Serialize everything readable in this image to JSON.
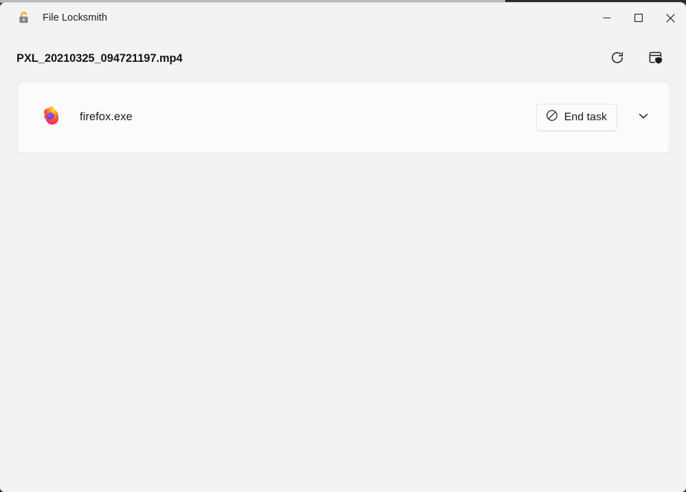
{
  "window": {
    "title": "File Locksmith",
    "app_icon": "unlocked-padlock-icon",
    "controls": {
      "minimize": "minimize-icon",
      "maximize": "maximize-icon",
      "close": "close-icon"
    }
  },
  "header": {
    "file_name": "PXL_20210325_094721197.mp4",
    "actions": [
      {
        "name": "refresh-icon",
        "label": "Refresh"
      },
      {
        "name": "restart-as-admin-icon",
        "label": "Restart as administrator"
      }
    ]
  },
  "processes": [
    {
      "icon": "firefox-icon",
      "name": "firefox.exe",
      "end_task_label": "End task",
      "end_task_icon": "prohibition-icon",
      "expander_icon": "chevron-down-icon"
    }
  ],
  "colors": {
    "window_background": "#f3f3f3",
    "card_background": "#fbfbfb",
    "card_border": "#e6e6e6",
    "text_primary": "#1b1b1b",
    "padlock_shackle": "#f5a623",
    "padlock_body": "#7f8186",
    "firefox_orange": "#ff9500",
    "firefox_purple": "#7542e5",
    "firefox_pink": "#ff2a75"
  }
}
